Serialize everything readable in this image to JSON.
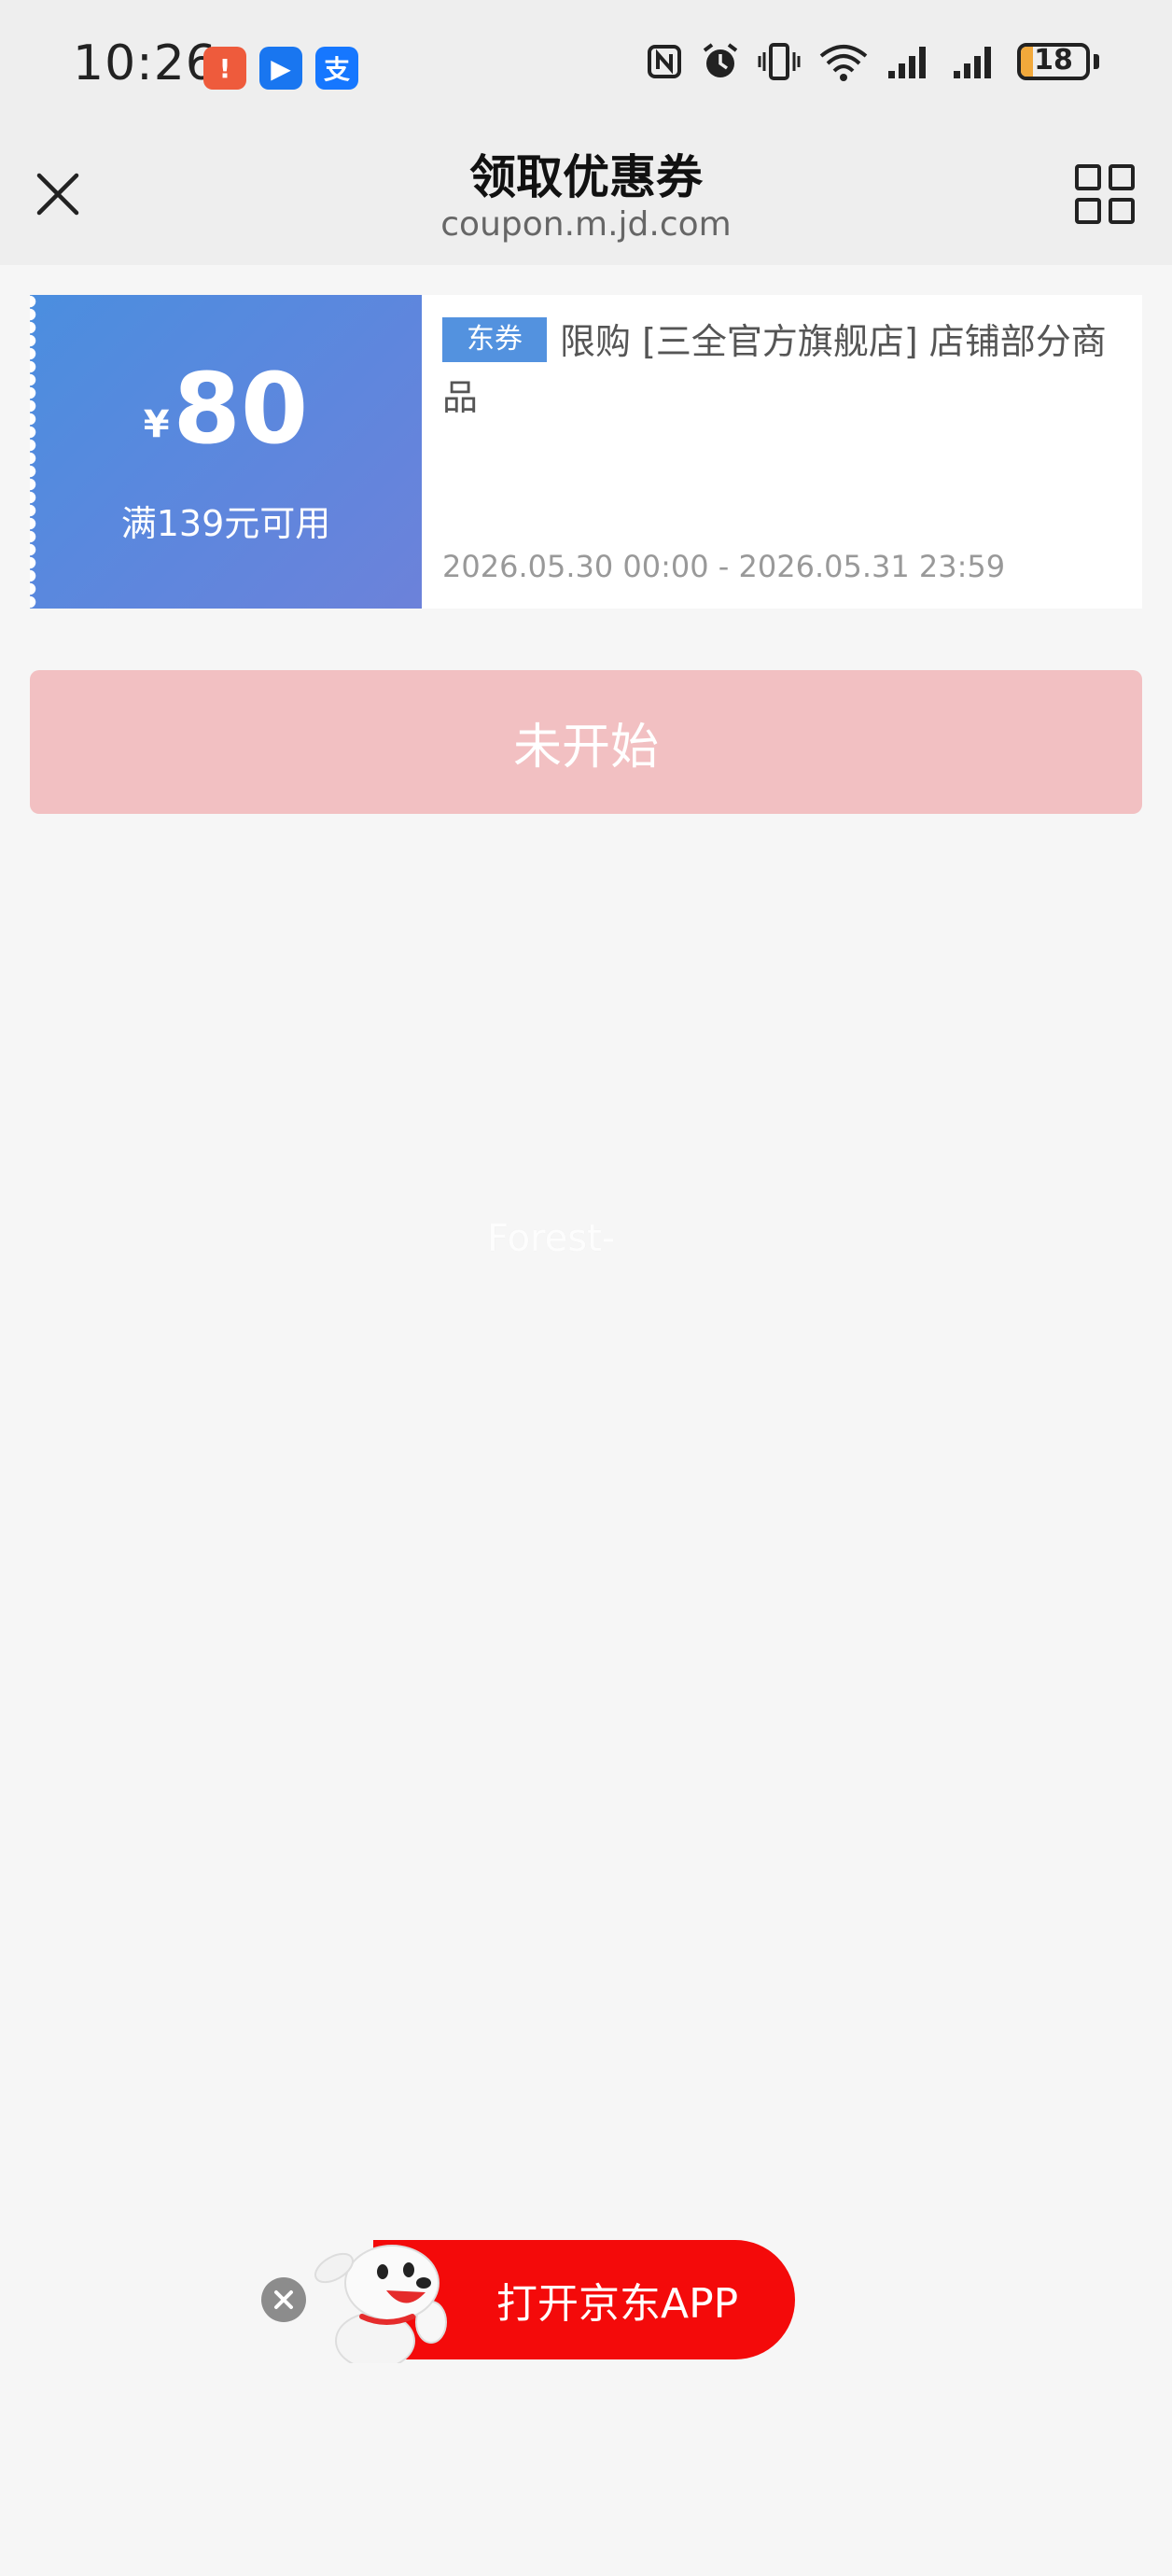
{
  "status_bar": {
    "time": "10:26",
    "app_badges": [
      "!",
      "▶",
      "支"
    ],
    "battery_level": "18",
    "battery_fraction": 0.18,
    "icons": [
      "nfc-icon",
      "alarm-icon",
      "vibrate-icon",
      "wifi-icon",
      "signal-icon",
      "signal-icon",
      "battery-icon"
    ]
  },
  "nav": {
    "title": "领取优惠券",
    "url": "coupon.m.jd.com",
    "left_icon": "close-icon",
    "right_icon": "grid-menu-icon"
  },
  "coupon": {
    "currency": "¥",
    "amount": "80",
    "condition": "满139元可用",
    "tag": "东券",
    "description": "限购 [三全官方旗舰店] 店铺部分商品",
    "validity": "2026.05.30 00:00 - 2026.05.31 23:59",
    "accent_color": "#4b8edf"
  },
  "action": {
    "label": "未开始",
    "color": "#f2c0c2"
  },
  "watermark": "Forest-",
  "banner": {
    "open_app_label": "打开京东APP",
    "brand_color": "#f40a0a",
    "mascot_icon": "jd-dog-mascot-icon",
    "close_icon": "close-circle-icon"
  }
}
